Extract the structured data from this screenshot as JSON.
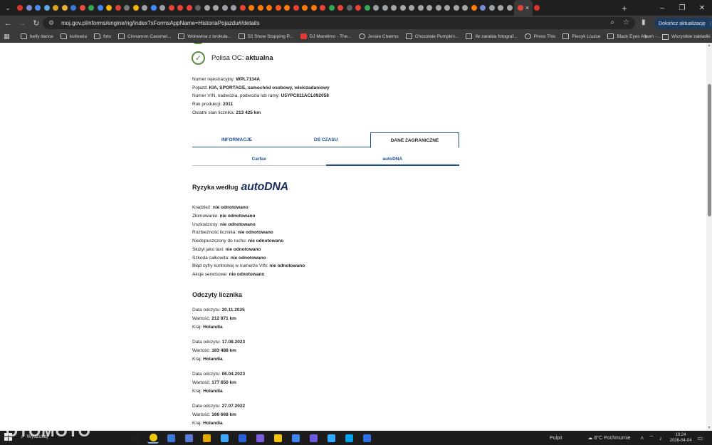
{
  "browser": {
    "active_tab_close": "×",
    "new_tab": "+",
    "window_controls": [
      "–",
      "❐",
      "✕"
    ],
    "url": "moj.gov.pl/nforms/engine/ng/index?xFormsAppName=HistoriaPojazdu#/details",
    "update_button": "Dokończ aktualizację",
    "tab_favicon_colors": [
      "#e0362c",
      "#7a8cd6",
      "#4e8ef7",
      "#5fa8e6",
      "#d9a21f",
      "#e8b23a",
      "#3c78d8",
      "#e74c3c",
      "#34a853",
      "#4285f4",
      "#f4b400",
      "#db4437",
      "#7a7a7a",
      "#f4b400",
      "#9aa0a6",
      "#3f8cff",
      "#9aa0a6",
      "#ea4335",
      "#ea4335",
      "#ea4335",
      "#5f6368",
      "#a6a6a6",
      "#a6a6a6",
      "#9aa0a6",
      "#9aa0a6",
      "#ea4335",
      "#ff7a00",
      "#ff7a00",
      "#ff7a00",
      "#ff5722",
      "#ff7a00",
      "#ea4335",
      "#ff7a00",
      "#ff7a00",
      "#ea4335",
      "#34a853",
      "#ea4335",
      "#5f6368",
      "#ea4335",
      "#34a853",
      "#9aa0a6",
      "#9aa0a6",
      "#a6a6a6",
      "#a6a6a6",
      "#a6a6a6",
      "#a6a6a6",
      "#a6a6a6",
      "#a6a6a6",
      "#a6a6a6",
      "#a6a6a6",
      "#a6a6a6",
      "#ff7a00",
      "#7a8cd6",
      "#9aa0a6",
      "#a6a6a6",
      "#a6a6a6",
      "#ea4335",
      "#e0362c"
    ]
  },
  "bookmarks": {
    "items": [
      {
        "label": "belly dance",
        "icon": "folder-icon"
      },
      {
        "label": "kulinaria",
        "icon": "folder-icon"
      },
      {
        "label": "foto",
        "icon": "folder-icon"
      },
      {
        "label": "Cinnamon Caramel...",
        "icon": "page-icon"
      },
      {
        "label": "Wołowina z brokuła...",
        "icon": "page-icon"
      },
      {
        "label": "50 Show Stopping P...",
        "icon": "page-icon"
      },
      {
        "label": "DJ Maretimo - The...",
        "icon": "youtube-icon"
      },
      {
        "label": "Jessie Charms",
        "icon": "globe-icon"
      },
      {
        "label": "Chocolate Pumpkin...",
        "icon": "page-icon"
      },
      {
        "label": "Ile zarabia fotograf...",
        "icon": "page-icon"
      },
      {
        "label": "Press This",
        "icon": "globe-icon"
      },
      {
        "label": "Piecyk Louise",
        "icon": "page-icon"
      },
      {
        "label": "Black Eyes Album -...",
        "icon": "page-icon"
      }
    ],
    "more": "»",
    "all": "Wszystkie zakładki"
  },
  "vehicle": {
    "policy_label": "Polisa OC:",
    "policy_status": "aktualna",
    "fields": [
      {
        "label": "Numer rejestracyjny:",
        "value": "WPL7134A"
      },
      {
        "label": "Pojazd:",
        "value": "KIA, SPORTAGE, samochód osobowy, wielozadaniowy"
      },
      {
        "label": "Numer VIN, nadwozia, podwozia lub ramy:",
        "value": "U5YPC811ACL092058"
      },
      {
        "label": "Rok produkcji:",
        "value": "2011"
      },
      {
        "label": "Ostatni stan licznika:",
        "value": "213 425 km"
      }
    ]
  },
  "tabs": [
    "INFORMACJE",
    "OŚ CZASU",
    "DANE ZAGRANICZNE"
  ],
  "subtabs": [
    "Carfax",
    "autoDNA"
  ],
  "risk": {
    "title": "Ryzyka według",
    "brand": "autoDNA",
    "items": [
      {
        "label": "Kradzież:",
        "value": "nie odnotowano"
      },
      {
        "label": "Złomowanie:",
        "value": "nie odnotowano"
      },
      {
        "label": "Uszkodzony:",
        "value": "nie odnotowano"
      },
      {
        "label": "Rozbieżność licznika:",
        "value": "nie odnotowano"
      },
      {
        "label": "Niedopuszczony do ruchu:",
        "value": "nie odnotowano"
      },
      {
        "label": "Służył jako taxi:",
        "value": "nie odnotowano"
      },
      {
        "label": "Szkoda całkowita:",
        "value": "nie odnotowano"
      },
      {
        "label": "Błąd cyfry kontrolnej w numerze VIN:",
        "value": "nie odnotowano"
      },
      {
        "label": "Akcje serwisowe:",
        "value": "nie odnotowano"
      }
    ]
  },
  "readings": {
    "title": "Odczyty licznika",
    "labels": {
      "date": "Data odczytu:",
      "value": "Wartość:",
      "country": "Kraj:"
    },
    "items": [
      {
        "date": "20.11.2025",
        "value": "212 871 km",
        "country": "Holandia"
      },
      {
        "date": "17.08.2023",
        "value": "183 488 km",
        "country": "Holandia"
      },
      {
        "date": "06.04.2023",
        "value": "177 650 km",
        "country": "Holandia"
      },
      {
        "date": "27.07.2022",
        "value": "166 668 km",
        "country": "Holandia"
      }
    ]
  },
  "taskbar": {
    "watermark": "OTOMOTO",
    "search": "Wyszukaj",
    "desktop": "Pulpit",
    "temperature": "8°C",
    "weather": "Pochmurnie",
    "time": "10:24",
    "date": "2026-04-04",
    "app_colors": [
      "#1e1e1e",
      "#f0c808",
      "#3c78d8",
      "#5a7bd5",
      "#e0a800",
      "#3ea6ff",
      "#2b5fd9",
      "#7c5ce0",
      "#f4c20d",
      "#4285f4",
      "#6a5be0",
      "#31a8ff",
      "#00a2ed",
      "#2f6fea"
    ]
  },
  "colors": {
    "accent": "#1c4f90",
    "ok": "#5b8c3e",
    "brand": "#1d2f5f"
  }
}
